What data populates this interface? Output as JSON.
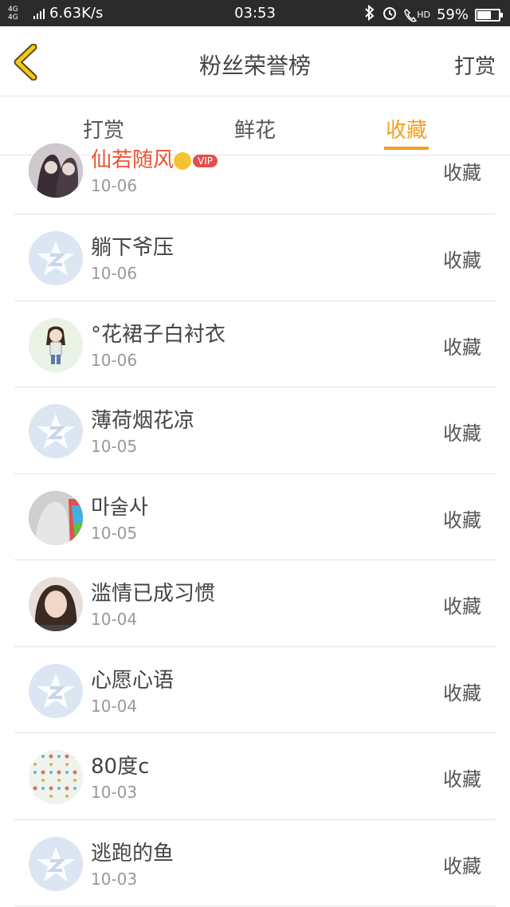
{
  "status_bar": {
    "network": "4G 4G",
    "speed": "6.63K/s",
    "time": "03:53",
    "hd": "HD",
    "battery_percent": "59%",
    "battery_level": 0.59
  },
  "header": {
    "title": "粉丝荣誉榜",
    "action_label": "打赏"
  },
  "tabs": [
    {
      "label": "打赏",
      "active": false
    },
    {
      "label": "鲜花",
      "active": false
    },
    {
      "label": "收藏",
      "active": true
    }
  ],
  "accent_color": "#f0a020",
  "list": [
    {
      "name": "仙若随风",
      "date": "10-06",
      "action": "收藏",
      "vip": true,
      "vip_label": "VIP",
      "avatar": "photo-avatar"
    },
    {
      "name": "躺下爷压",
      "date": "10-06",
      "action": "收藏",
      "vip": false,
      "avatar": "default-avatar"
    },
    {
      "name": "°花裙子白衬衣",
      "date": "10-06",
      "action": "收藏",
      "vip": false,
      "avatar": "cartoon-avatar"
    },
    {
      "name": "薄荷烟花凉",
      "date": "10-05",
      "action": "收藏",
      "vip": false,
      "avatar": "default-avatar"
    },
    {
      "name": "마술사",
      "date": "10-05",
      "action": "收藏",
      "vip": false,
      "avatar": "photo-avatar"
    },
    {
      "name": "滥情已成习惯",
      "date": "10-04",
      "action": "收藏",
      "vip": false,
      "avatar": "photo-avatar"
    },
    {
      "name": "心愿心语",
      "date": "10-04",
      "action": "收藏",
      "vip": false,
      "avatar": "default-avatar"
    },
    {
      "name": "80度c",
      "date": "10-03",
      "action": "收藏",
      "vip": false,
      "avatar": "pattern-avatar"
    },
    {
      "name": "逃跑的鱼",
      "date": "10-03",
      "action": "收藏",
      "vip": false,
      "avatar": "default-avatar"
    }
  ]
}
